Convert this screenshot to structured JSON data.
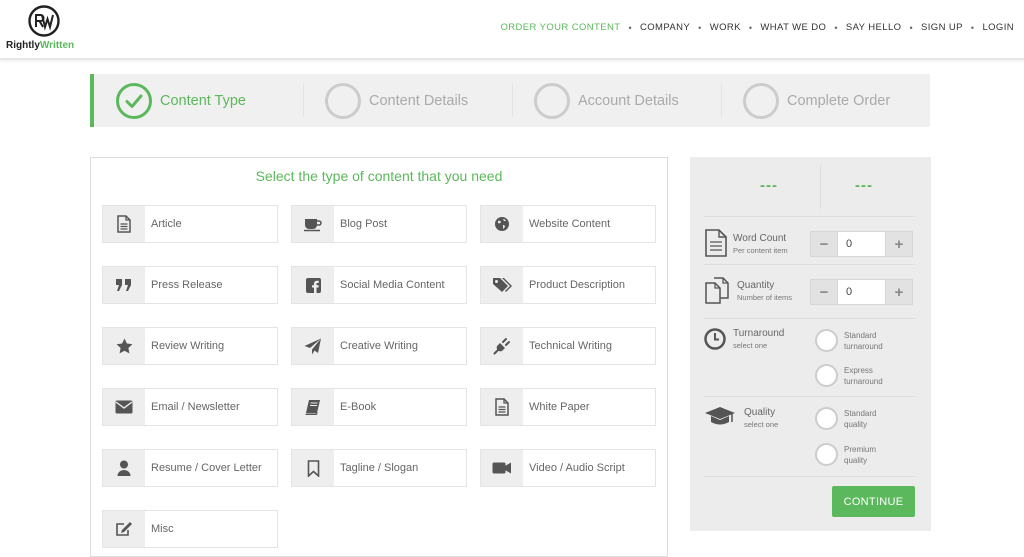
{
  "brand": {
    "name_part1": "Rightly",
    "name_part2": "Written",
    "accent": "#5cb85c"
  },
  "nav": {
    "items": [
      {
        "label": "ORDER YOUR CONTENT",
        "active": true
      },
      {
        "label": "COMPANY"
      },
      {
        "label": "WORK"
      },
      {
        "label": "WHAT WE DO"
      },
      {
        "label": "SAY HELLO"
      },
      {
        "label": "SIGN UP"
      },
      {
        "label": "LOGIN"
      }
    ]
  },
  "steps": [
    {
      "label": "Content Type",
      "status": "done"
    },
    {
      "label": "Content Details",
      "status": "pending"
    },
    {
      "label": "Account Details",
      "status": "pending"
    },
    {
      "label": "Complete Order",
      "status": "pending"
    }
  ],
  "content_panel": {
    "title": "Select the type of content that you need",
    "tiles": [
      {
        "label": "Article",
        "icon": "document-icon"
      },
      {
        "label": "Blog Post",
        "icon": "coffee-cup-icon"
      },
      {
        "label": "Website Content",
        "icon": "globe-icon"
      },
      {
        "label": "Press Release",
        "icon": "quote-icon"
      },
      {
        "label": "Social Media Content",
        "icon": "facebook-icon"
      },
      {
        "label": "Product Description",
        "icon": "tags-icon"
      },
      {
        "label": "Review Writing",
        "icon": "star-icon"
      },
      {
        "label": "Creative Writing",
        "icon": "paper-plane-icon"
      },
      {
        "label": "Technical Writing",
        "icon": "plug-icon"
      },
      {
        "label": "Email / Newsletter",
        "icon": "envelope-icon"
      },
      {
        "label": "E-Book",
        "icon": "book-icon"
      },
      {
        "label": "White Paper",
        "icon": "document-icon"
      },
      {
        "label": "Resume / Cover Letter",
        "icon": "user-icon"
      },
      {
        "label": "Tagline / Slogan",
        "icon": "bookmark-icon"
      },
      {
        "label": "Video / Audio Script",
        "icon": "video-camera-icon"
      },
      {
        "label": "Misc",
        "icon": "edit-icon"
      }
    ]
  },
  "summary": {
    "left_value": "---",
    "right_value": "---",
    "word_count": {
      "label": "Word Count",
      "sub": "Per content item",
      "value": "0",
      "minus": "−",
      "plus": "+"
    },
    "quantity": {
      "label": "Quantity",
      "sub": "Number of items",
      "value": "0",
      "minus": "−",
      "plus": "+"
    },
    "turnaround": {
      "label": "Turnaround",
      "sub": "select one",
      "options": [
        {
          "line1": "Standard",
          "line2": "turnaround"
        },
        {
          "line1": "Express",
          "line2": "turnaround"
        }
      ]
    },
    "quality": {
      "label": "Quality",
      "sub": "select one",
      "options": [
        {
          "line1": "Standard",
          "line2": "quality"
        },
        {
          "line1": "Premium",
          "line2": "quality"
        }
      ]
    },
    "continue_label": "CONTINUE"
  }
}
